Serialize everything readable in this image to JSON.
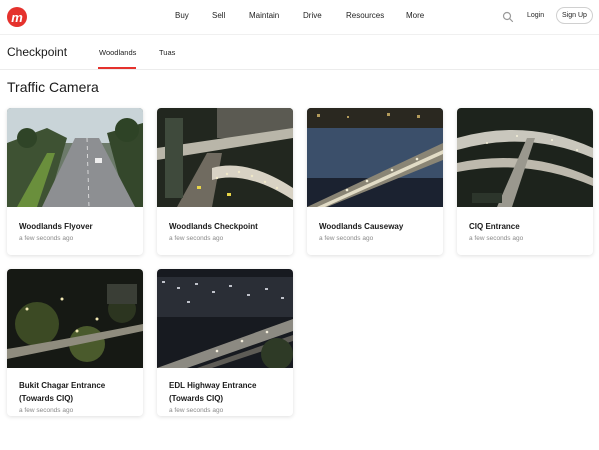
{
  "header": {
    "logo_text": "m",
    "nav": [
      "Buy",
      "Sell",
      "Maintain",
      "Drive",
      "Resources",
      "More"
    ],
    "login_label": "Login",
    "signup_label": "Sign Up",
    "brand_color": "#e5322d"
  },
  "section": {
    "title": "Checkpoint",
    "tabs": [
      "Woodlands",
      "Tuas"
    ],
    "active_tab": "Woodlands"
  },
  "page": {
    "heading": "Traffic Camera"
  },
  "cameras": [
    {
      "title": "Woodlands Flyover",
      "time": "a few seconds ago"
    },
    {
      "title": "Woodlands Checkpoint",
      "time": "a few seconds ago"
    },
    {
      "title": "Woodlands Causeway",
      "time": "a few seconds ago"
    },
    {
      "title": "CIQ Entrance",
      "time": "a few seconds ago"
    },
    {
      "title": "Bukit Chagar Entrance (Towards CIQ)",
      "time": "a few seconds ago"
    },
    {
      "title": "EDL Highway Entrance (Towards CIQ)",
      "time": "a few seconds ago"
    }
  ]
}
